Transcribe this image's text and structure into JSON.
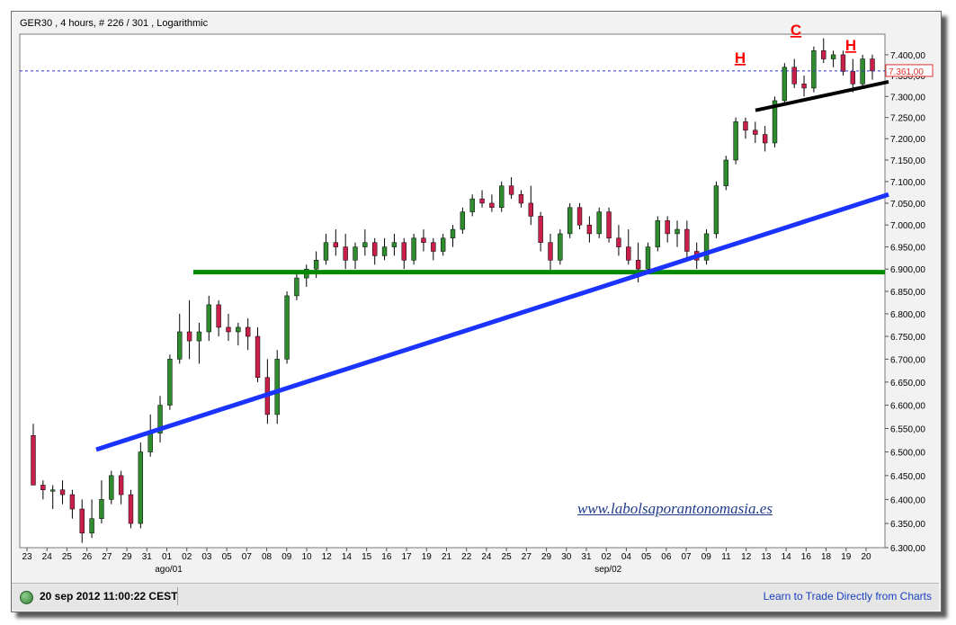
{
  "header": {
    "title": "GER30 , 4 hours, # 226 / 301 , Logarithmic"
  },
  "status": {
    "timestamp": "20 sep 2012 11:00:22 CEST",
    "link": "Learn to Trade Directly from Charts"
  },
  "watermark": "www.labolsaporantonomasia.es",
  "colors": {
    "up": "#2e8b2e",
    "down": "#c8204a",
    "support": "#008800",
    "trend": "#1a33ff",
    "neckline": "#000000",
    "label": "#ff0000"
  },
  "chart_data": {
    "type": "candlestick",
    "ylim": [
      6300,
      7450
    ],
    "y_scale": "log",
    "y_ticks": [
      "6.300,00",
      "6.350,00",
      "6.400,00",
      "6.450,00",
      "6.500,00",
      "6.550,00",
      "6.600,00",
      "6.650,00",
      "6.700,00",
      "6.750,00",
      "6.800,00",
      "6.850,00",
      "6.900,00",
      "6.950,00",
      "7.000,00",
      "7.050,00",
      "7.100,00",
      "7.150,00",
      "7.200,00",
      "7.250,00",
      "7.300,00",
      "7.350,00",
      "7.400,00"
    ],
    "x_ticks": [
      "23",
      "24",
      "25",
      "26",
      "27",
      "29",
      "31",
      "01",
      "02",
      "03",
      "05",
      "07",
      "08",
      "09",
      "10",
      "12",
      "14",
      "15",
      "16",
      "17",
      "19",
      "21",
      "22",
      "24",
      "25",
      "27",
      "29",
      "30",
      "31",
      "02",
      "04",
      "05",
      "06",
      "07",
      "09",
      "11",
      "12",
      "13",
      "14",
      "16",
      "18",
      "19",
      "20"
    ],
    "x_major_labels": [
      "ago/01",
      "sep/02"
    ],
    "current_price": {
      "label": "7.361,00",
      "value": 7361
    },
    "candles": [
      [
        6535,
        6560,
        6440,
        6430
      ],
      [
        6430,
        6440,
        6400,
        6420
      ],
      [
        6420,
        6430,
        6380,
        6420
      ],
      [
        6420,
        6440,
        6390,
        6410
      ],
      [
        6410,
        6420,
        6360,
        6380
      ],
      [
        6380,
        6400,
        6310,
        6330
      ],
      [
        6330,
        6400,
        6320,
        6360
      ],
      [
        6360,
        6440,
        6350,
        6400
      ],
      [
        6400,
        6460,
        6390,
        6450
      ],
      [
        6450,
        6460,
        6390,
        6410
      ],
      [
        6410,
        6420,
        6340,
        6350
      ],
      [
        6350,
        6520,
        6340,
        6500
      ],
      [
        6500,
        6580,
        6490,
        6540
      ],
      [
        6540,
        6620,
        6520,
        6600
      ],
      [
        6600,
        6710,
        6590,
        6700
      ],
      [
        6700,
        6800,
        6690,
        6760
      ],
      [
        6760,
        6830,
        6700,
        6740
      ],
      [
        6740,
        6780,
        6690,
        6760
      ],
      [
        6760,
        6840,
        6740,
        6820
      ],
      [
        6820,
        6830,
        6750,
        6770
      ],
      [
        6770,
        6800,
        6740,
        6760
      ],
      [
        6760,
        6780,
        6730,
        6770
      ],
      [
        6770,
        6790,
        6720,
        6750
      ],
      [
        6750,
        6770,
        6650,
        6660
      ],
      [
        6660,
        6700,
        6560,
        6580
      ],
      [
        6580,
        6720,
        6560,
        6700
      ],
      [
        6700,
        6850,
        6690,
        6840
      ],
      [
        6840,
        6890,
        6830,
        6880
      ],
      [
        6880,
        6910,
        6860,
        6900
      ],
      [
        6900,
        6940,
        6880,
        6920
      ],
      [
        6920,
        6980,
        6910,
        6960
      ],
      [
        6960,
        6990,
        6930,
        6950
      ],
      [
        6950,
        6980,
        6900,
        6920
      ],
      [
        6920,
        6960,
        6900,
        6950
      ],
      [
        6950,
        6990,
        6930,
        6960
      ],
      [
        6960,
        6970,
        6910,
        6930
      ],
      [
        6930,
        6970,
        6920,
        6950
      ],
      [
        6950,
        6980,
        6930,
        6960
      ],
      [
        6960,
        6970,
        6900,
        6920
      ],
      [
        6920,
        6980,
        6910,
        6970
      ],
      [
        6970,
        6990,
        6940,
        6960
      ],
      [
        6960,
        6970,
        6920,
        6940
      ],
      [
        6940,
        6980,
        6930,
        6970
      ],
      [
        6970,
        7000,
        6950,
        6990
      ],
      [
        6990,
        7040,
        6980,
        7030
      ],
      [
        7030,
        7070,
        7020,
        7060
      ],
      [
        7060,
        7080,
        7040,
        7050
      ],
      [
        7050,
        7070,
        7030,
        7040
      ],
      [
        7040,
        7100,
        7030,
        7090
      ],
      [
        7090,
        7110,
        7060,
        7070
      ],
      [
        7070,
        7080,
        7040,
        7050
      ],
      [
        7050,
        7090,
        7000,
        7020
      ],
      [
        7020,
        7030,
        6940,
        6960
      ],
      [
        6960,
        6980,
        6890,
        6920
      ],
      [
        6920,
        6990,
        6910,
        6980
      ],
      [
        6980,
        7050,
        6970,
        7040
      ],
      [
        7040,
        7050,
        6990,
        7000
      ],
      [
        7000,
        7020,
        6960,
        6980
      ],
      [
        6980,
        7040,
        6970,
        7030
      ],
      [
        7030,
        7040,
        6960,
        6970
      ],
      [
        6970,
        7000,
        6930,
        6950
      ],
      [
        6950,
        6990,
        6910,
        6920
      ],
      [
        6920,
        6960,
        6870,
        6900
      ],
      [
        6900,
        6960,
        6890,
        6950
      ],
      [
        6950,
        7020,
        6940,
        7010
      ],
      [
        7010,
        7020,
        6960,
        6980
      ],
      [
        6980,
        7010,
        6950,
        6990
      ],
      [
        6990,
        7010,
        6920,
        6940
      ],
      [
        6940,
        6960,
        6900,
        6920
      ],
      [
        6920,
        6990,
        6910,
        6980
      ],
      [
        6980,
        7100,
        6970,
        7090
      ],
      [
        7090,
        7160,
        7080,
        7150
      ],
      [
        7150,
        7250,
        7140,
        7240
      ],
      [
        7240,
        7250,
        7200,
        7220
      ],
      [
        7220,
        7240,
        7190,
        7210
      ],
      [
        7210,
        7230,
        7170,
        7190
      ],
      [
        7190,
        7300,
        7180,
        7290
      ],
      [
        7290,
        7380,
        7280,
        7370
      ],
      [
        7370,
        7390,
        7320,
        7330
      ],
      [
        7330,
        7350,
        7300,
        7320
      ],
      [
        7320,
        7420,
        7310,
        7410
      ],
      [
        7410,
        7440,
        7380,
        7390
      ],
      [
        7390,
        7410,
        7370,
        7400
      ],
      [
        7400,
        7410,
        7350,
        7360
      ],
      [
        7360,
        7390,
        7310,
        7330
      ],
      [
        7330,
        7400,
        7320,
        7390
      ],
      [
        7390,
        7400,
        7340,
        7361
      ]
    ],
    "annotations": [
      "H",
      "C",
      "H"
    ]
  }
}
